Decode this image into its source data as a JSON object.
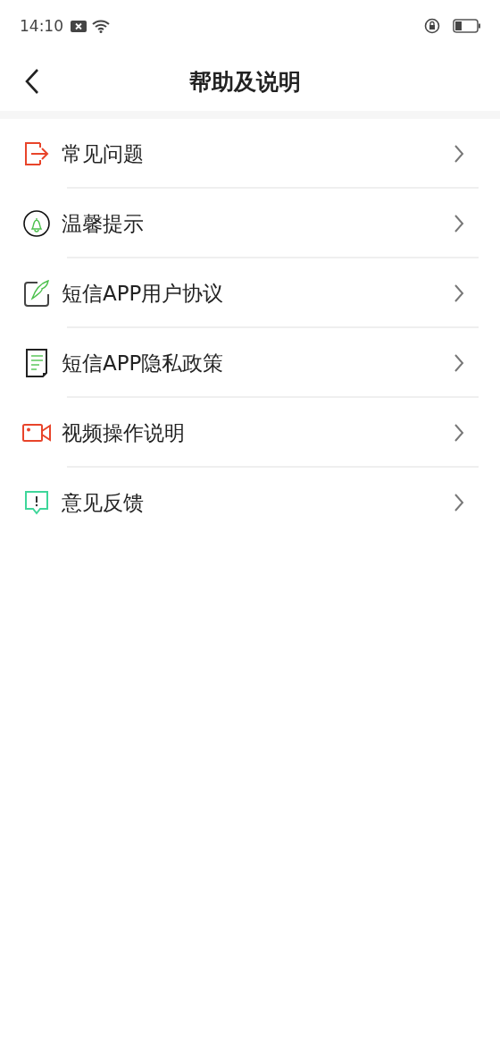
{
  "status_bar": {
    "time": "14:10"
  },
  "header": {
    "title": "帮助及说明"
  },
  "menu": [
    {
      "kind": "exit",
      "label": "常见问题"
    },
    {
      "kind": "bell",
      "label": "温馨提示"
    },
    {
      "kind": "pen",
      "label": "短信APP用户协议"
    },
    {
      "kind": "document",
      "label": "短信APP隐私政策"
    },
    {
      "kind": "video",
      "label": "视频操作说明"
    },
    {
      "kind": "feedback",
      "label": "意见反馈"
    }
  ]
}
